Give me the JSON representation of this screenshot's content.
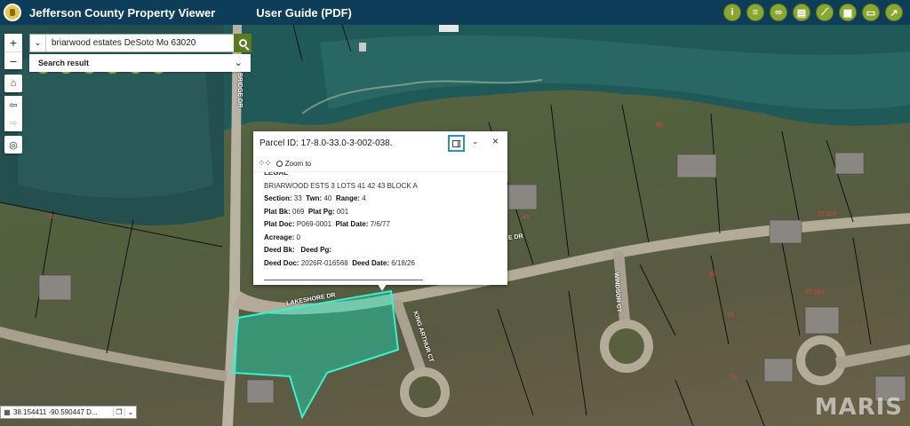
{
  "header": {
    "app_title": "Jefferson County Property Viewer",
    "user_guide_label": "User Guide (PDF)",
    "tools": [
      "info-icon",
      "layers-icon",
      "binoculars-icon",
      "print-icon",
      "measure-icon",
      "basemap-icon",
      "bookmark-icon",
      "share-icon"
    ],
    "accent_color": "#8aa830",
    "bar_color": "#0e3d5a"
  },
  "map_controls": {
    "zoom_in": "+",
    "zoom_out": "−",
    "home": "⌂",
    "back": "⇦",
    "forward": "⇨",
    "locate": "◎"
  },
  "search": {
    "value": "briarwood estates DeSoto Mo 63020",
    "clear": "×",
    "result_label": "Search result"
  },
  "popup": {
    "title": "Parcel ID: 17-8.0-33.0-3-002-038.",
    "zoom_to_label": "Zoom to",
    "section_heading": "LEGAL",
    "legal_description": "BRIARWOOD ESTS 3 LOTS 41 42 43 BLOCK A",
    "fields": {
      "section_label": "Section:",
      "section": "33",
      "twn_label": "Twn:",
      "twn": "40",
      "range_label": "Range:",
      "range": "4",
      "plat_bk_label": "Plat Bk:",
      "plat_bk": "069",
      "plat_pg_label": "Plat Pg:",
      "plat_pg": "001",
      "plat_doc_label": "Plat Doc:",
      "plat_doc": "P069-0001",
      "plat_date_label": "Plat Date:",
      "plat_date": "7/6/77",
      "acreage_label": "Acreage:",
      "acreage": "0",
      "deed_bk_label": "Deed Bk:",
      "deed_bk": "",
      "deed_pg_label": "Deed Pg:",
      "deed_pg": "",
      "deed_doc_label": "Deed Doc:",
      "deed_doc": "2026R-016568",
      "deed_date_label": "Deed Date:",
      "deed_date": "6/18/26"
    }
  },
  "coords": {
    "value": "38.154411 -90.590447 D..."
  },
  "roads": {
    "lakeshore_1": "LAKESHORE DR",
    "lakeshore_2": "E DR",
    "king_arthur": "KING ARTHUR CT",
    "windsor": "WINDSOR CT",
    "vertical": "BRIDGE DR"
  },
  "lot_labels": [
    "70",
    "82",
    "50",
    "37.304",
    "33",
    "37.264",
    "70",
    "43"
  ],
  "watermark": "MARIS"
}
